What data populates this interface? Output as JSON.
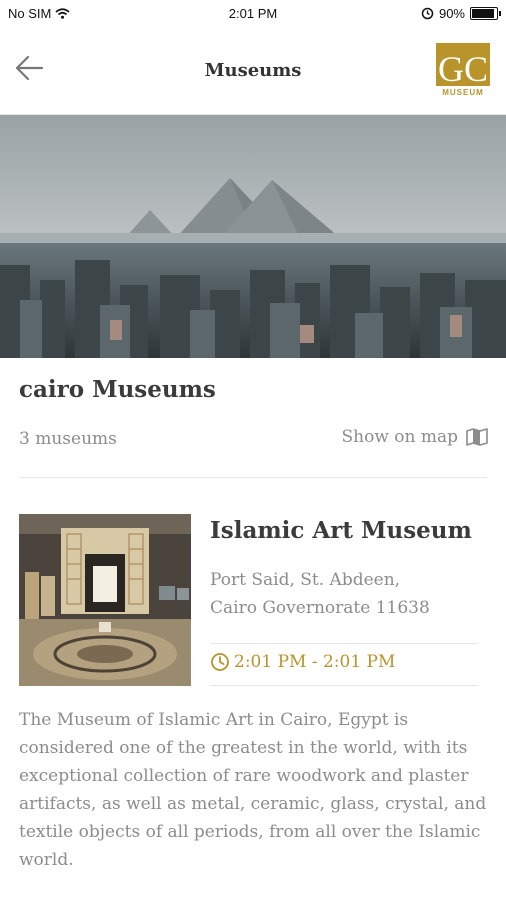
{
  "status_bar": {
    "carrier": "No SIM",
    "time": "2:01 PM",
    "battery_percent": "90%",
    "battery_level": 0.9
  },
  "nav": {
    "title": "Museums",
    "logo_text": "GC",
    "logo_subtext": "MUSEUM"
  },
  "section": {
    "title": "cairo Museums",
    "count": "3 museums",
    "show_on_map": "Show on map"
  },
  "museum": {
    "name": "Islamic Art Museum",
    "address_line1": "Port Said, St. Abdeen,",
    "address_line2": "Cairo Governorate 11638",
    "hours": "2:01 PM - 2:01 PM",
    "description": "The Museum of Islamic Art in Cairo, Egypt is considered one of the greatest in the world, with its exceptional collection of rare woodwork and plaster artifacts, as well as metal, ceramic, glass, crystal, and textile objects of all periods, from all over the Islamic world."
  },
  "colors": {
    "accent": "#b8942b",
    "text": "#3b3b3b",
    "muted": "#8c8c8c",
    "divider": "#e6e6e6"
  },
  "icons": [
    "back-arrow-icon",
    "wifi-icon",
    "alarm-lock-icon",
    "battery-icon",
    "map-icon",
    "clock-icon"
  ]
}
